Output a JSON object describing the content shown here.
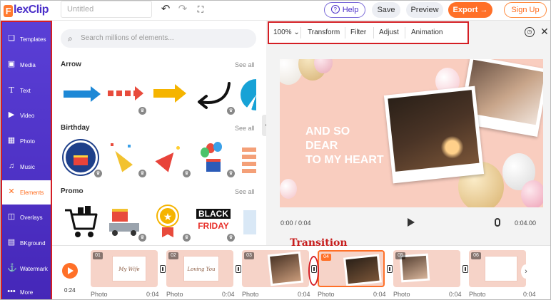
{
  "app": {
    "logo_text": "lexClip",
    "logo_letter": "F"
  },
  "header": {
    "title_placeholder": "Untitled",
    "undo_icon": "undo-icon",
    "redo_icon": "redo-icon",
    "fullscreen_icon": "fullscreen-icon",
    "help_label": "Help",
    "save_label": "Save",
    "preview_label": "Preview",
    "export_label": "Export",
    "signup_label": "Sign Up",
    "accent_color": "#ff7028",
    "brand_color": "#4b2fc9"
  },
  "sidebar": {
    "items": [
      {
        "label": "Templates",
        "icon": "layers-icon"
      },
      {
        "label": "Media",
        "icon": "folder-icon"
      },
      {
        "label": "Text",
        "icon": "text-icon"
      },
      {
        "label": "Video",
        "icon": "video-icon"
      },
      {
        "label": "Photo",
        "icon": "image-icon"
      },
      {
        "label": "Music",
        "icon": "music-icon"
      },
      {
        "label": "Elements",
        "icon": "elements-icon",
        "active": true
      },
      {
        "label": "Overlays",
        "icon": "overlays-icon"
      },
      {
        "label": "BKground",
        "icon": "background-icon"
      },
      {
        "label": "Watermark",
        "icon": "watermark-icon"
      },
      {
        "label": "More",
        "icon": "more-icon"
      }
    ]
  },
  "panel": {
    "search_placeholder": "Search millions of elements...",
    "sections": [
      {
        "title": "Arrow",
        "see_all": "See all"
      },
      {
        "title": "Birthday",
        "see_all": "See all"
      },
      {
        "title": "Promo",
        "see_all": "See all"
      }
    ],
    "promo_black": "BLACK",
    "promo_friday": "FRIDAY"
  },
  "toolbar": {
    "zoom": "100%",
    "transform": "Transform",
    "filter": "Filter",
    "adjust": "Adjust",
    "animation": "Animation"
  },
  "canvas": {
    "headline_line1": "AND SO DEAR",
    "headline_line2": "TO MY HEART",
    "background_color": "#f9cdbf"
  },
  "player": {
    "current_time": "0:00 / 0:04",
    "total_time": "0:04.00"
  },
  "timeline": {
    "total": "0:24",
    "clips": [
      {
        "num": "01",
        "type": "Photo",
        "duration": "0:04",
        "caption": "My Wife"
      },
      {
        "num": "02",
        "type": "Photo",
        "duration": "0:04",
        "caption": "Loving You"
      },
      {
        "num": "03",
        "type": "Photo",
        "duration": "0:04",
        "caption": ""
      },
      {
        "num": "04",
        "type": "Photo",
        "duration": "0:04",
        "caption": ""
      },
      {
        "num": "05",
        "type": "Photo",
        "duration": "0:04",
        "caption": ""
      },
      {
        "num": "06",
        "type": "Photo",
        "duration": "0:04",
        "caption": ""
      }
    ]
  },
  "annotation": {
    "transition_label": "Transition"
  }
}
